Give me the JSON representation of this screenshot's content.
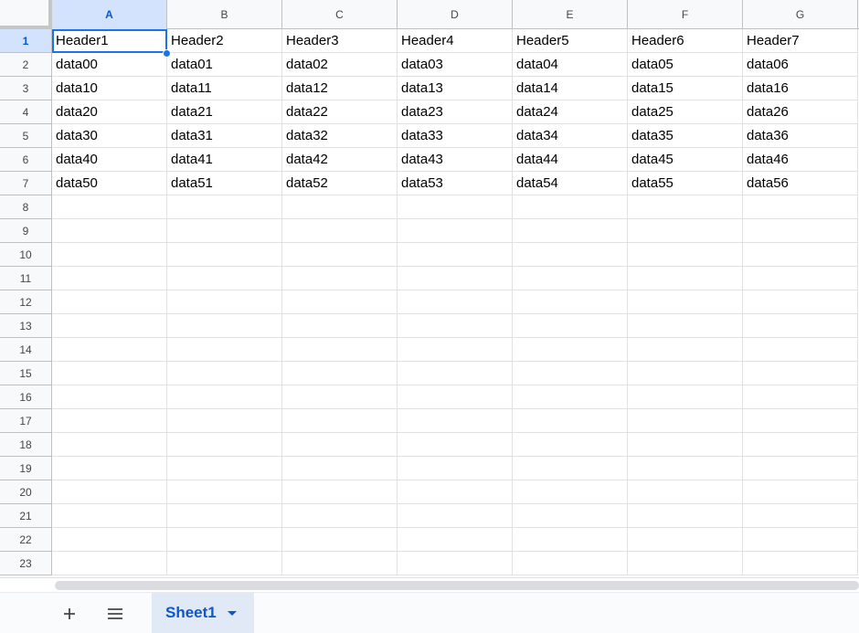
{
  "columns": [
    "A",
    "B",
    "C",
    "D",
    "E",
    "F",
    "G"
  ],
  "selected_column": "A",
  "selected_row": "1",
  "rows": [
    "1",
    "2",
    "3",
    "4",
    "5",
    "6",
    "7",
    "8",
    "9",
    "10",
    "11",
    "12",
    "13",
    "14",
    "15",
    "16",
    "17",
    "18",
    "19",
    "20",
    "21",
    "22",
    "23"
  ],
  "cells": [
    [
      "Header1",
      "Header2",
      "Header3",
      "Header4",
      "Header5",
      "Header6",
      "Header7"
    ],
    [
      "data00",
      "data01",
      "data02",
      "data03",
      "data04",
      "data05",
      "data06"
    ],
    [
      "data10",
      "data11",
      "data12",
      "data13",
      "data14",
      "data15",
      "data16"
    ],
    [
      "data20",
      "data21",
      "data22",
      "data23",
      "data24",
      "data25",
      "data26"
    ],
    [
      "data30",
      "data31",
      "data32",
      "data33",
      "data34",
      "data35",
      "data36"
    ],
    [
      "data40",
      "data41",
      "data42",
      "data43",
      "data44",
      "data45",
      "data46"
    ],
    [
      "data50",
      "data51",
      "data52",
      "data53",
      "data54",
      "data55",
      "data56"
    ]
  ],
  "bottom_bar": {
    "add_sheet_icon": "plus-icon",
    "all_sheets_icon": "menu-icon",
    "sheet_tab_label": "Sheet1",
    "sheet_tab_menu_icon": "caret-down-icon"
  },
  "colors": {
    "accent": "#1a73e8",
    "selected_header_bg": "#d3e3fd",
    "selected_header_text": "#0b57d0",
    "sheet_tab_bg": "#e1e9f7"
  }
}
